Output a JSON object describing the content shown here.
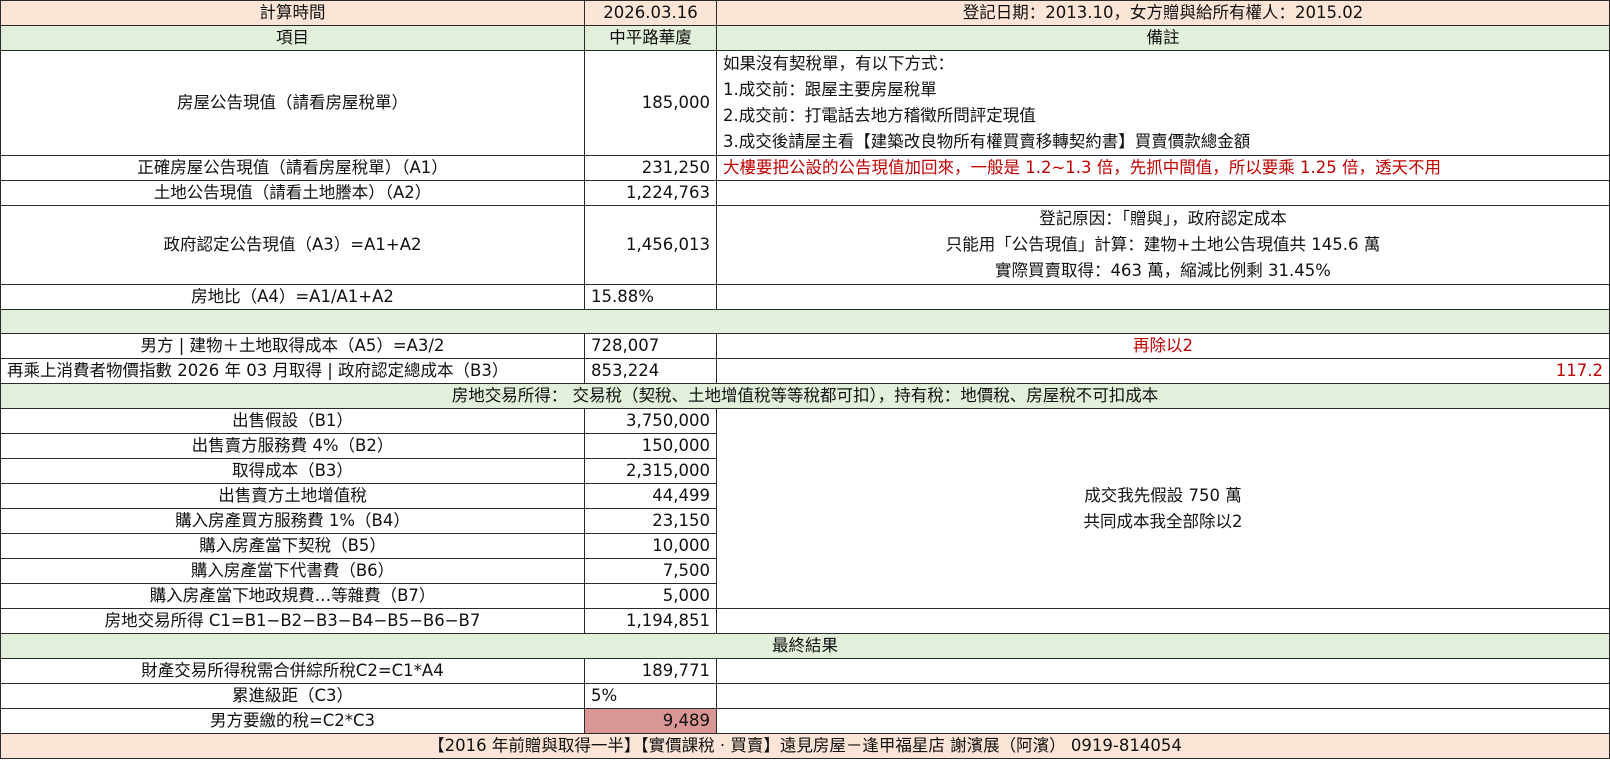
{
  "header": {
    "calc_label": "計算時間",
    "calc_value": "2026.03.16",
    "reg_info": "登記日期：2013.10，女方贈與給所有權人：2015.02"
  },
  "columns": {
    "item": "項目",
    "property": "中平路華廈",
    "note": "備註"
  },
  "rows": {
    "house_value": {
      "label": "房屋公告現值（請看房屋稅單）",
      "value": "185,000",
      "notes": [
        " 如果沒有契稅單，有以下方式：",
        "1.成交前：跟屋主要房屋稅單",
        "2.成交前：打電話去地方稽徵所問評定現值",
        "3.成交後請屋主看【建築改良物所有權買賣移轉契約書】買賣價款總金額"
      ]
    },
    "correct_house": {
      "label": "正確房屋公告現值（請看房屋稅單）（A1）",
      "value": "231,250",
      "note": "大樓要把公設的公告現值加回來，一般是 1.2~1.3 倍，先抓中間值，所以要乘 1.25 倍，透天不用"
    },
    "land_value": {
      "label": "土地公告現值（請看土地謄本）（A2）",
      "value": "1,224,763"
    },
    "gov_value": {
      "label": "政府認定公告現值（A3）=A1+A2",
      "value": "1,456,013",
      "notes": [
        "登記原因：「贈與」，政府認定成本",
        "只能用「公告現值」計算：建物+土地公告現值共 145.6 萬",
        "實際買賣取得：463 萬，縮減比例剩 31.45%"
      ]
    },
    "ratio": {
      "label": "房地比（A4）=A1/A1+A2",
      "value": "15.88%"
    },
    "male_cost": {
      "label": "男方 | 建物＋土地取得成本（A5）=A3/2",
      "value": "728,007",
      "note": "再除以2"
    },
    "cpi_cost": {
      "label": "再乘上消費者物價指數 2026 年 03 月取得 | 政府認定總成本（B3）",
      "value": "853,224",
      "note": "117.2"
    }
  },
  "section_title": "房地交易所得： 交易稅（契稅、土地增值稅等等稅都可扣），持有稅：地價稅、房屋稅不可扣成本",
  "sale_rows": [
    {
      "label": "出售假設（B1）",
      "value": "3,750,000"
    },
    {
      "label": "出售賣方服務費 4%（B2）",
      "value": "150,000"
    },
    {
      "label": "取得成本（B3）",
      "value": "2,315,000"
    },
    {
      "label": "出售賣方土地增值稅",
      "value": "44,499"
    },
    {
      "label": "購入房產買方服務費 1%（B4）",
      "value": "23,150"
    },
    {
      "label": "購入房產當下契稅（B5）",
      "value": "10,000"
    },
    {
      "label": "購入房產當下代書費（B6）",
      "value": "7,500"
    },
    {
      "label": "購入房產當下地政規費…等雜費（B7）",
      "value": "5,000"
    }
  ],
  "sale_note": [
    "成交我先假設 750 萬",
    "共同成本我全部除以2"
  ],
  "income_row": {
    "label": "房地交易所得 C1=B1−B2−B3−B4−B5−B6−B7",
    "value": "1,194,851"
  },
  "final_title": "最終結果",
  "final_rows": [
    {
      "label": "財產交易所得稅需合併綜所稅C2=C1*A4",
      "value": "189,771"
    },
    {
      "label": "累進級距（C3）",
      "value": "5%"
    },
    {
      "label": "男方要繳的稅=C2*C3",
      "value": "9,489"
    }
  ],
  "footer": "【2016 年前贈與取得一半】【實價課稅 · 買賣】遠見房屋－逢甲福星店 謝濱展（阿濱） 0919-814054",
  "colors": {
    "peach": "#fce4d6",
    "green": "#e2efda",
    "highlight": "#d99694",
    "red_text": "#c00000"
  }
}
